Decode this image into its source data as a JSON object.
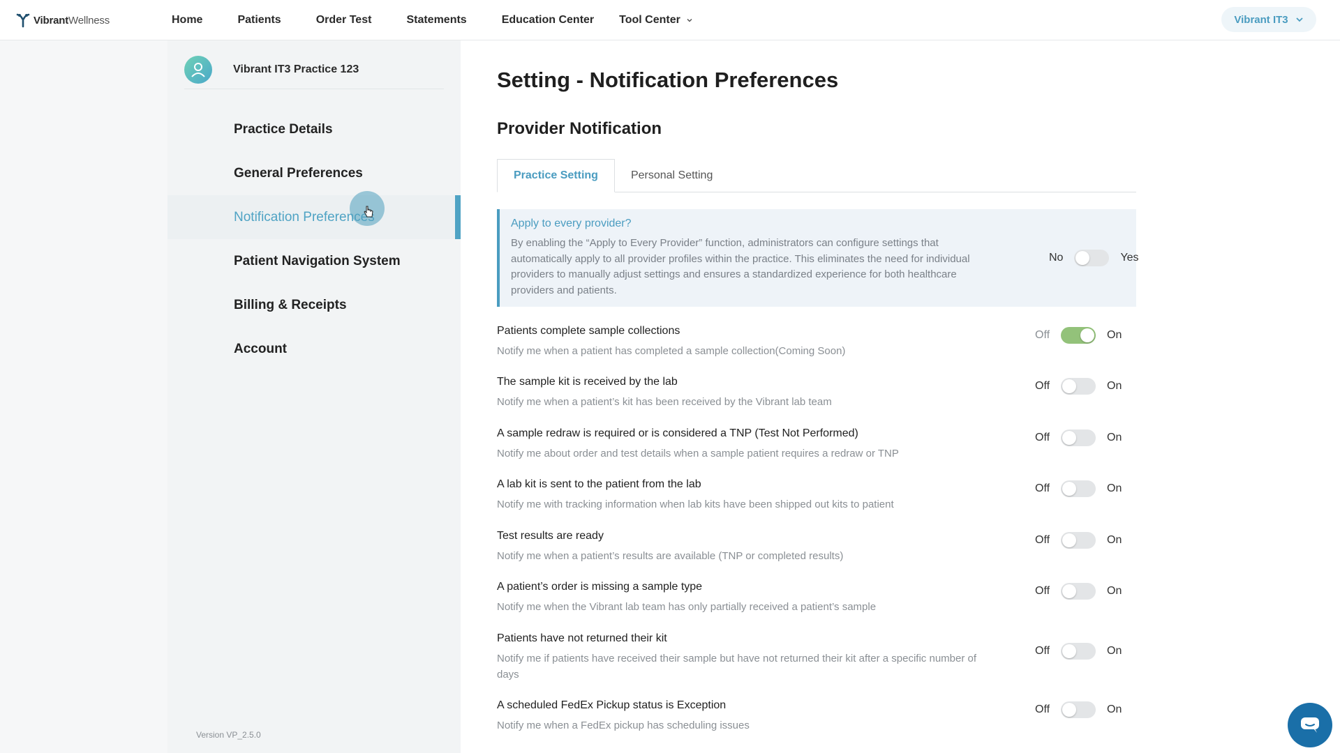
{
  "brand": {
    "name_bold": "Vibrant",
    "name_light": "Wellness"
  },
  "nav": {
    "items": [
      {
        "label": "Home"
      },
      {
        "label": "Patients"
      },
      {
        "label": "Order Test"
      },
      {
        "label": "Statements"
      },
      {
        "label": "Education Center"
      },
      {
        "label": "Tool Center"
      }
    ],
    "account_label": "Vibrant IT3"
  },
  "sidebar": {
    "practice_name": "Vibrant IT3 Practice 123",
    "items": [
      {
        "label": "Practice Details"
      },
      {
        "label": "General Preferences"
      },
      {
        "label": "Notification Preferences",
        "active": true
      },
      {
        "label": "Patient Navigation System"
      },
      {
        "label": "Billing & Receipts"
      },
      {
        "label": "Account"
      }
    ],
    "version": "Version VP_2.5.0"
  },
  "main": {
    "title": "Setting - Notification Preferences",
    "section_title": "Provider Notification",
    "tabs": [
      {
        "label": "Practice Setting",
        "active": true
      },
      {
        "label": "Personal Setting"
      }
    ],
    "apply": {
      "title": "Apply to every provider?",
      "description": "By enabling the “Apply to Every Provider” function, administrators can configure settings that automatically apply to all provider profiles within the practice. This eliminates the need for individual providers to manually adjust settings and ensures a standardized experience for both healthcare providers and patients.",
      "off_label": "No",
      "on_label": "Yes",
      "enabled": false
    },
    "off_label": "Off",
    "on_label": "On",
    "settings": [
      {
        "title": "Patients complete sample collections",
        "description": "Notify me when a patient has completed a sample collection(Coming Soon)",
        "enabled": true
      },
      {
        "title": "The sample kit is received by the lab",
        "description": "Notify me when a patient’s kit has been received by the Vibrant lab team",
        "enabled": false
      },
      {
        "title": "A sample redraw is required or is considered a TNP (Test Not Performed)",
        "description": "Notify me about order and test details when a sample patient requires a redraw or TNP",
        "enabled": false
      },
      {
        "title": "A lab kit is sent to the patient from the lab",
        "description": "Notify me with tracking information when lab kits have been shipped out kits to patient",
        "enabled": false
      },
      {
        "title": "Test results are ready",
        "description": "Notify me when a patient’s results are available (TNP or completed results)",
        "enabled": false
      },
      {
        "title": "A patient’s order is missing a sample type",
        "description": "Notify me when the Vibrant lab team has only partially received a patient’s sample",
        "enabled": false
      },
      {
        "title": "Patients have not returned their kit",
        "description": "Notify me if patients have received their sample but have not returned their kit after a specific number of days",
        "enabled": false
      },
      {
        "title": "A scheduled FedEx Pickup status is Exception",
        "description": "Notify me when a FedEx pickup has scheduling issues",
        "enabled": false
      }
    ]
  }
}
